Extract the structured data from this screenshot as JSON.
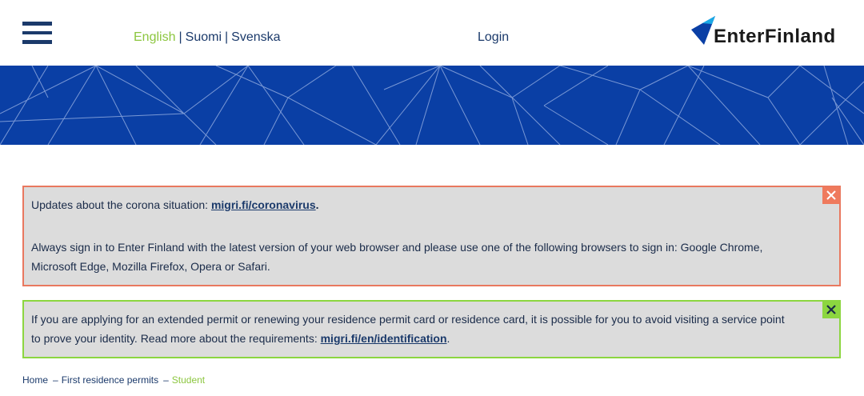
{
  "header": {
    "languages": [
      {
        "label": "English",
        "active": true
      },
      {
        "label": "Suomi",
        "active": false
      },
      {
        "label": "Svenska",
        "active": false
      }
    ],
    "separator": "|",
    "login_label": "Login",
    "logo_text": "EnterFinland"
  },
  "notices": {
    "corona": {
      "line1_prefix": "Updates about the corona situation: ",
      "line1_link": "migri.fi/coronavirus",
      "line1_suffix": ".",
      "line2": "Always sign in to Enter Finland with the latest version of your web browser and please use one of the following browsers to sign in: Google Chrome, Microsoft Edge, Mozilla Firefox, Opera or Safari."
    },
    "identification": {
      "text_prefix": "If you are applying for an extended permit or renewing your residence permit card or residence card, it is possible for you to avoid visiting a service point to prove your identity. Read more about the requirements: ",
      "link": "migri.fi/en/identification",
      "text_suffix": "."
    }
  },
  "breadcrumb": {
    "items": [
      "Home",
      "First residence permits"
    ],
    "current": "Student",
    "separator": "–"
  },
  "colors": {
    "brand_blue": "#0a3fa5",
    "navy": "#1b3a6b",
    "accent_green": "#8cc63f",
    "alert_red": "#ef7a5d"
  }
}
